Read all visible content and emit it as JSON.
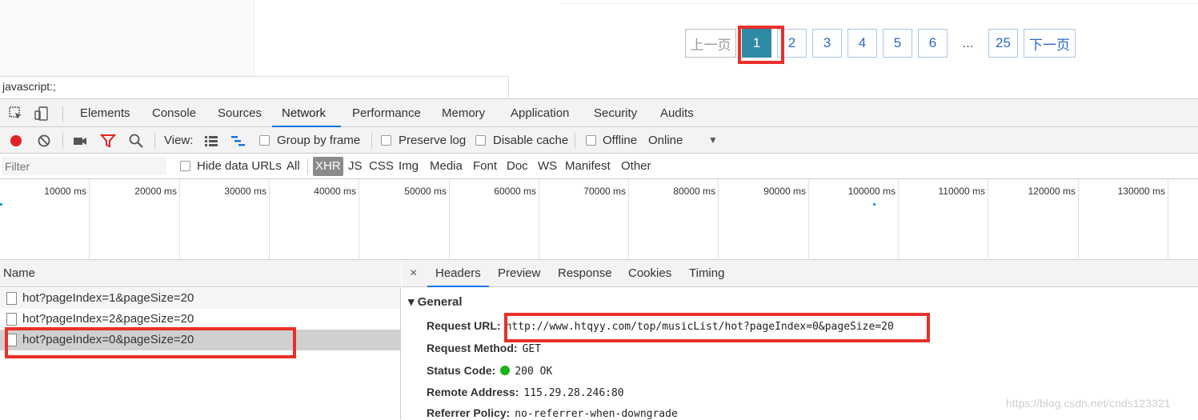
{
  "pagination": {
    "prev": "上一页",
    "pages": [
      "1",
      "2",
      "3",
      "4",
      "5",
      "6"
    ],
    "ellipsis": "...",
    "last": "25",
    "next": "下一页",
    "active": "1"
  },
  "status_bar": {
    "text": "javascript:;"
  },
  "devtools": {
    "tabs": [
      "Elements",
      "Console",
      "Sources",
      "Network",
      "Performance",
      "Memory",
      "Application",
      "Security",
      "Audits"
    ],
    "active_tab": "Network",
    "toolbar": {
      "view_label": "View:",
      "group_by_frame": "Group by frame",
      "preserve_log": "Preserve log",
      "disable_cache": "Disable cache",
      "offline": "Offline",
      "throttle": "Online"
    },
    "filter": {
      "placeholder": "Filter",
      "hide_data_urls": "Hide data URLs",
      "types": [
        "All",
        "XHR",
        "JS",
        "CSS",
        "Img",
        "Media",
        "Font",
        "Doc",
        "WS",
        "Manifest",
        "Other"
      ],
      "active_type": "XHR"
    },
    "timeline": {
      "ticks": [
        "10000 ms",
        "20000 ms",
        "30000 ms",
        "40000 ms",
        "50000 ms",
        "60000 ms",
        "70000 ms",
        "80000 ms",
        "90000 ms",
        "100000 ms",
        "110000 ms",
        "120000 ms",
        "130000 ms"
      ]
    },
    "requests": {
      "header": "Name",
      "rows": [
        "hot?pageIndex=1&pageSize=20",
        "hot?pageIndex=2&pageSize=20",
        "hot?pageIndex=0&pageSize=20"
      ],
      "selected_index": 2
    },
    "detail": {
      "close": "×",
      "tabs": [
        "Headers",
        "Preview",
        "Response",
        "Cookies",
        "Timing"
      ],
      "active_tab": "Headers",
      "section": "▾ General",
      "fields": [
        {
          "key": "Request URL:",
          "value": "http://www.htqyy.com/top/musicList/hot?pageIndex=0&pageSize=20"
        },
        {
          "key": "Request Method:",
          "value": "GET"
        },
        {
          "key": "Status Code:",
          "value": "200 OK"
        },
        {
          "key": "Remote Address:",
          "value": "115.29.28.246:80"
        },
        {
          "key": "Referrer Policy:",
          "value": "no-referrer-when-downgrade"
        }
      ]
    }
  },
  "colors": {
    "accent": "#1a73e8",
    "active_page": "#2f8aa6",
    "highlight": "#e8302a",
    "status_ok": "#1db31d"
  },
  "watermark": "https://blog.csdn.net/cnds123321"
}
